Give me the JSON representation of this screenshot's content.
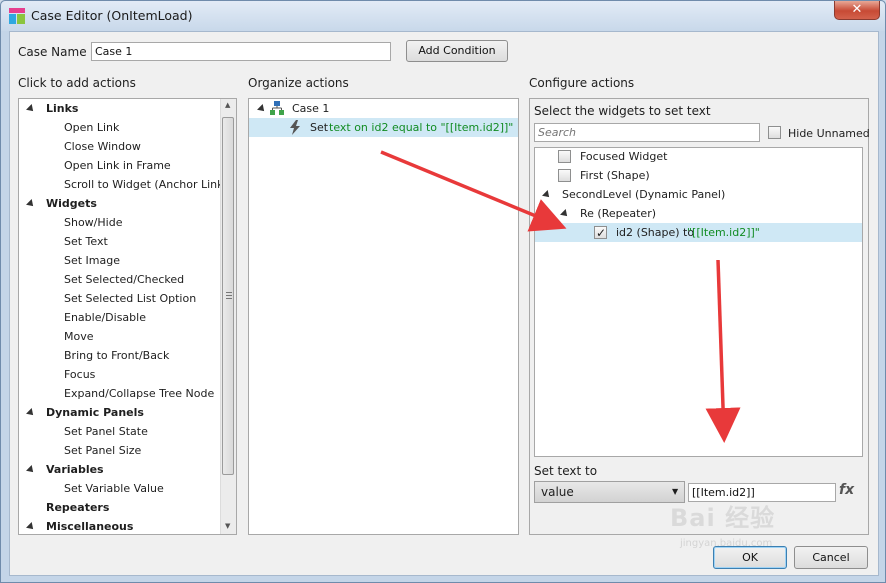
{
  "window": {
    "title": "Case Editor (OnItemLoad)",
    "close_label": "✕"
  },
  "case_name": {
    "label": "Case Name",
    "value": "Case 1",
    "add_condition_label": "Add Condition"
  },
  "left_panel": {
    "heading": "Click to add actions",
    "items": [
      {
        "label": "Links",
        "kind": "section",
        "state": "open"
      },
      {
        "label": "Open Link",
        "kind": "item",
        "state": "closed"
      },
      {
        "label": "Close Window",
        "kind": "item",
        "state": "none"
      },
      {
        "label": "Open Link in Frame",
        "kind": "item",
        "state": "closed"
      },
      {
        "label": "Scroll to Widget (Anchor Link)",
        "kind": "item",
        "state": "none"
      },
      {
        "label": "Widgets",
        "kind": "section",
        "state": "open"
      },
      {
        "label": "Show/Hide",
        "kind": "item",
        "state": "closed"
      },
      {
        "label": "Set Text",
        "kind": "item",
        "state": "none"
      },
      {
        "label": "Set Image",
        "kind": "item",
        "state": "none"
      },
      {
        "label": "Set Selected/Checked",
        "kind": "item",
        "state": "closed"
      },
      {
        "label": "Set Selected List Option",
        "kind": "item",
        "state": "none"
      },
      {
        "label": "Enable/Disable",
        "kind": "item",
        "state": "closed"
      },
      {
        "label": "Move",
        "kind": "item",
        "state": "none"
      },
      {
        "label": "Bring to Front/Back",
        "kind": "item",
        "state": "closed"
      },
      {
        "label": "Focus",
        "kind": "item",
        "state": "none"
      },
      {
        "label": "Expand/Collapse Tree Node",
        "kind": "item",
        "state": "closed"
      },
      {
        "label": "Dynamic Panels",
        "kind": "section",
        "state": "open"
      },
      {
        "label": "Set Panel State",
        "kind": "item",
        "state": "none"
      },
      {
        "label": "Set Panel Size",
        "kind": "item",
        "state": "none"
      },
      {
        "label": "Variables",
        "kind": "section",
        "state": "open"
      },
      {
        "label": "Set Variable Value",
        "kind": "item",
        "state": "none"
      },
      {
        "label": "Repeaters",
        "kind": "section",
        "state": "closed"
      },
      {
        "label": "Miscellaneous",
        "kind": "section",
        "state": "open"
      }
    ]
  },
  "middle_panel": {
    "heading": "Organize actions",
    "case_label": "Case 1",
    "action": {
      "verb": "Set ",
      "detail": "text on id2 equal to \"[[Item.id2]]\""
    }
  },
  "right_panel": {
    "heading": "Configure actions",
    "select_label": "Select the widgets to set text",
    "search_placeholder": "Search",
    "hide_unnamed_label": "Hide Unnamed",
    "tree": {
      "focused_widget": "Focused Widget",
      "first_shape": "First (Shape)",
      "second_level": "SecondLevel (Dynamic Panel)",
      "repeater": "Re (Repeater)",
      "id2_prefix": "id2 (Shape) to ",
      "id2_value": "\"[[Item.id2]]\""
    },
    "set_text_label": "Set text to",
    "set_text_type": "value",
    "set_text_value": "[[Item.id2]]",
    "fx_label": "fx"
  },
  "footer": {
    "ok_label": "OK",
    "cancel_label": "Cancel"
  },
  "colors": {
    "annotation_arrow": "#e8393a",
    "selection": "#cfe8f5",
    "highlight_text": "#128c23"
  },
  "watermark": {
    "line1": "Bai 经验",
    "line2": "jingyan.baidu.com"
  }
}
